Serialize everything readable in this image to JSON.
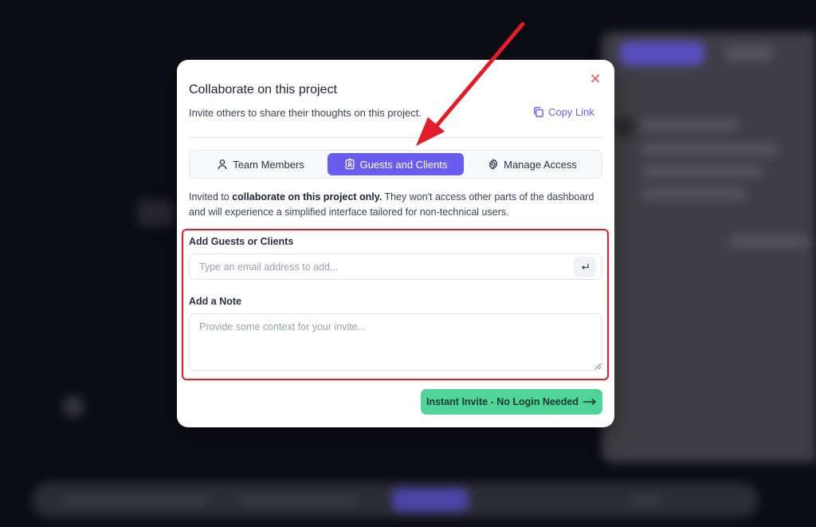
{
  "modal": {
    "title": "Collaborate on this project",
    "subtitle": "Invite others to share their thoughts on this project.",
    "copy_link": "Copy Link",
    "close_icon": "close-icon"
  },
  "tabs": [
    {
      "label": "Team Members",
      "icon": "user-icon",
      "active": false
    },
    {
      "label": "Guests and Clients",
      "icon": "id-badge-icon",
      "active": true
    },
    {
      "label": "Manage Access",
      "icon": "gear-icon",
      "active": false
    }
  ],
  "description": {
    "prefix": "Invited to ",
    "bold": "collaborate on this project only.",
    "suffix": " They won't access other parts of the dashboard and will experience a simplified interface tailored for non-technical users."
  },
  "guests_field": {
    "label": "Add Guests or Clients",
    "placeholder": "Type an email address to add...",
    "value": "",
    "enter_icon": "enter-return-icon"
  },
  "note_field": {
    "label": "Add a Note",
    "placeholder": "Provide some context for your invite...",
    "value": ""
  },
  "invite_button": {
    "label": "Instant Invite - No Login Needed",
    "icon": "arrow-right-icon"
  },
  "colors": {
    "accent": "#6b5cf0",
    "invite_button": "#4fd49a",
    "annotation": "#e11d2a",
    "close": "#e4606b"
  }
}
